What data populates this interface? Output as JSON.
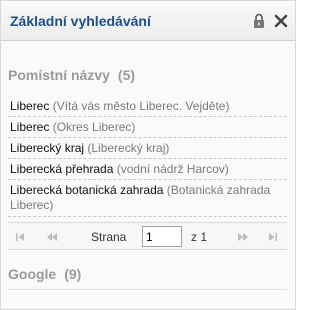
{
  "panel": {
    "title": "Základní vyhledávání"
  },
  "sections": {
    "places": {
      "label": "Pomístní názvy",
      "count": "(5)"
    },
    "google": {
      "label": "Google",
      "count": "(9)"
    }
  },
  "results": [
    {
      "name": "Liberec",
      "detail": "(Vítá vás město Liberec. Vejděte)"
    },
    {
      "name": "Liberec",
      "detail": "(Okres Liberec)"
    },
    {
      "name": "Liberecký kraj",
      "detail": "(Liberecký kraj)"
    },
    {
      "name": "Liberecká přehrada",
      "detail": "(vodní nádrž Harcov)"
    },
    {
      "name": "Liberecká botanická zahrada",
      "detail": "(Botanická zahrada Liberec)"
    }
  ],
  "pager": {
    "page_label": "Strana",
    "page_value": "1",
    "of_label": "z 1"
  },
  "icons": {
    "lock": "lock-icon",
    "close": "close-icon",
    "first": "first-page-icon",
    "prev": "prev-page-icon",
    "next": "next-page-icon",
    "last": "last-page-icon"
  },
  "colors": {
    "title": "#1c4f8c",
    "section": "#9a9a9a",
    "detail": "#7a7a7a"
  }
}
